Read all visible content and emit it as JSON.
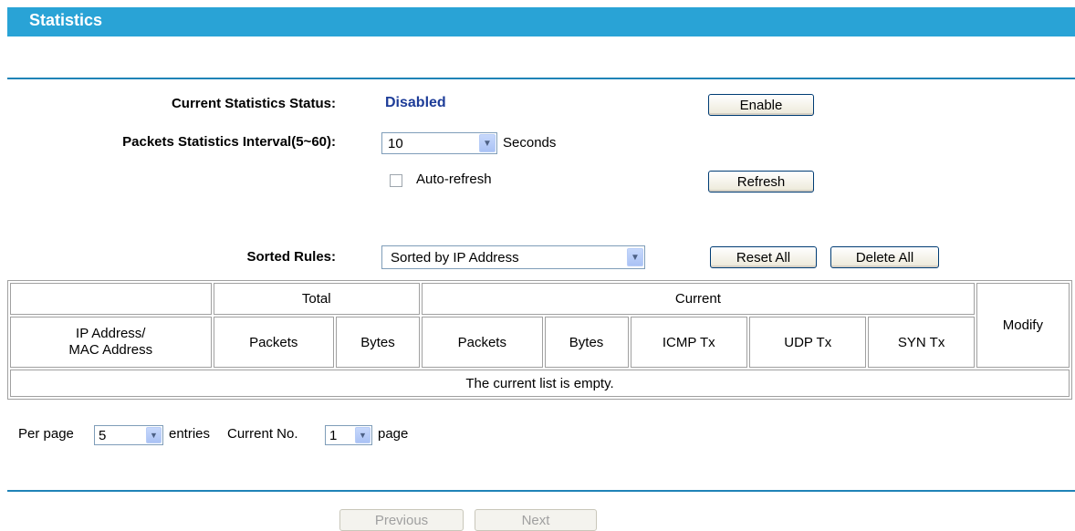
{
  "header": {
    "title": "Statistics"
  },
  "status": {
    "label": "Current Statistics Status:",
    "value": "Disabled",
    "enable_button": "Enable"
  },
  "interval": {
    "label": "Packets Statistics Interval(5~60):",
    "selected": "10",
    "unit": "Seconds"
  },
  "auto_refresh": {
    "label": "Auto-refresh",
    "checked": false
  },
  "refresh_button": "Refresh",
  "sorted_rules": {
    "label": "Sorted Rules:",
    "selected": "Sorted by IP Address",
    "reset_all_button": "Reset All",
    "delete_all_button": "Delete All"
  },
  "table": {
    "group_headers": {
      "total": "Total",
      "current": "Current",
      "modify": "Modify"
    },
    "columns": {
      "address": "IP Address/\nMAC Address",
      "total_packets": "Packets",
      "total_bytes": "Bytes",
      "current_packets": "Packets",
      "current_bytes": "Bytes",
      "icmp_tx": "ICMP Tx",
      "udp_tx": "UDP Tx",
      "syn_tx": "SYN Tx"
    },
    "empty_message": "The current list is empty."
  },
  "paging": {
    "per_page_label": "Per page",
    "per_page_value": "5",
    "entries_label": "entries",
    "current_no_label": "Current No.",
    "current_no_value": "1",
    "page_label": "page",
    "previous_button": "Previous",
    "next_button": "Next"
  },
  "colors": {
    "title_bar": "#29a3d6",
    "divider": "#1f83b7",
    "status_value": "#1d3c98"
  }
}
